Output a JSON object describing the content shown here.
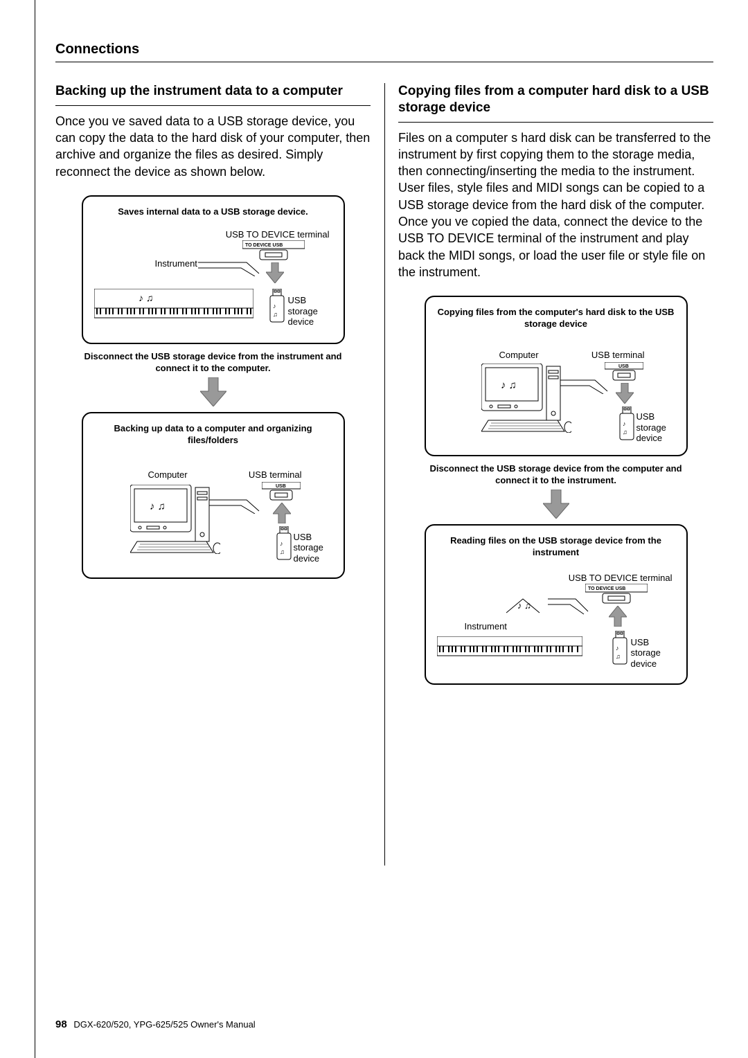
{
  "header": {
    "section": "Connections"
  },
  "left": {
    "heading": "Backing up the instrument data to a computer",
    "body": "Once you ve saved data to a USB storage device, you can copy the data to the hard disk of your computer, then archive and organize the ﬁles as desired. Simply reconnect the device as shown below.",
    "box1": {
      "title": "Saves internal data to a USB storage device.",
      "label_terminal": "USB TO DEVICE terminal",
      "label_instrument": "Instrument",
      "label_usb": "USB storage device",
      "port_text": "TO DEVICE   USB"
    },
    "transition1": "Disconnect the USB storage device from the instrument and connect it to the computer.",
    "box2": {
      "title": "Backing up data to a computer and organizing files/folders",
      "label_computer": "Computer",
      "label_terminal": "USB terminal",
      "label_usb": "USB storage device",
      "port_text": "USB"
    }
  },
  "right": {
    "heading": "Copying files from a computer hard disk to a USB storage device",
    "body": "Files on a computer s hard disk can be transferred to the instrument by ﬁrst copying them to the storage media, then connecting/inserting the media to the instrument. User ﬁles, style ﬁles and MIDI songs can be copied to a USB storage device from the hard disk of the computer. Once you ve copied the data, connect the device to the USB TO DEVICE terminal of the instrument and play back the MIDI songs, or load the user ﬁle or style ﬁle on the instrument.",
    "box1": {
      "title": "Copying files from the computer's hard disk to the USB storage device",
      "label_computer": "Computer",
      "label_terminal": "USB terminal",
      "label_usb": "USB storage device",
      "port_text": "USB"
    },
    "transition1": "Disconnect the USB storage device from the computer and connect it to the instrument.",
    "box2": {
      "title": "Reading files on the USB storage device from the instrument",
      "label_terminal": "USB TO DEVICE terminal",
      "label_instrument": "Instrument",
      "label_usb": "USB storage device",
      "port_text": "TO DEVICE   USB"
    }
  },
  "footer": {
    "page": "98",
    "manual": "DGX-620/520, YPG-625/525  Owner's Manual"
  },
  "icons": {
    "music_notes": "♪ ♫"
  }
}
